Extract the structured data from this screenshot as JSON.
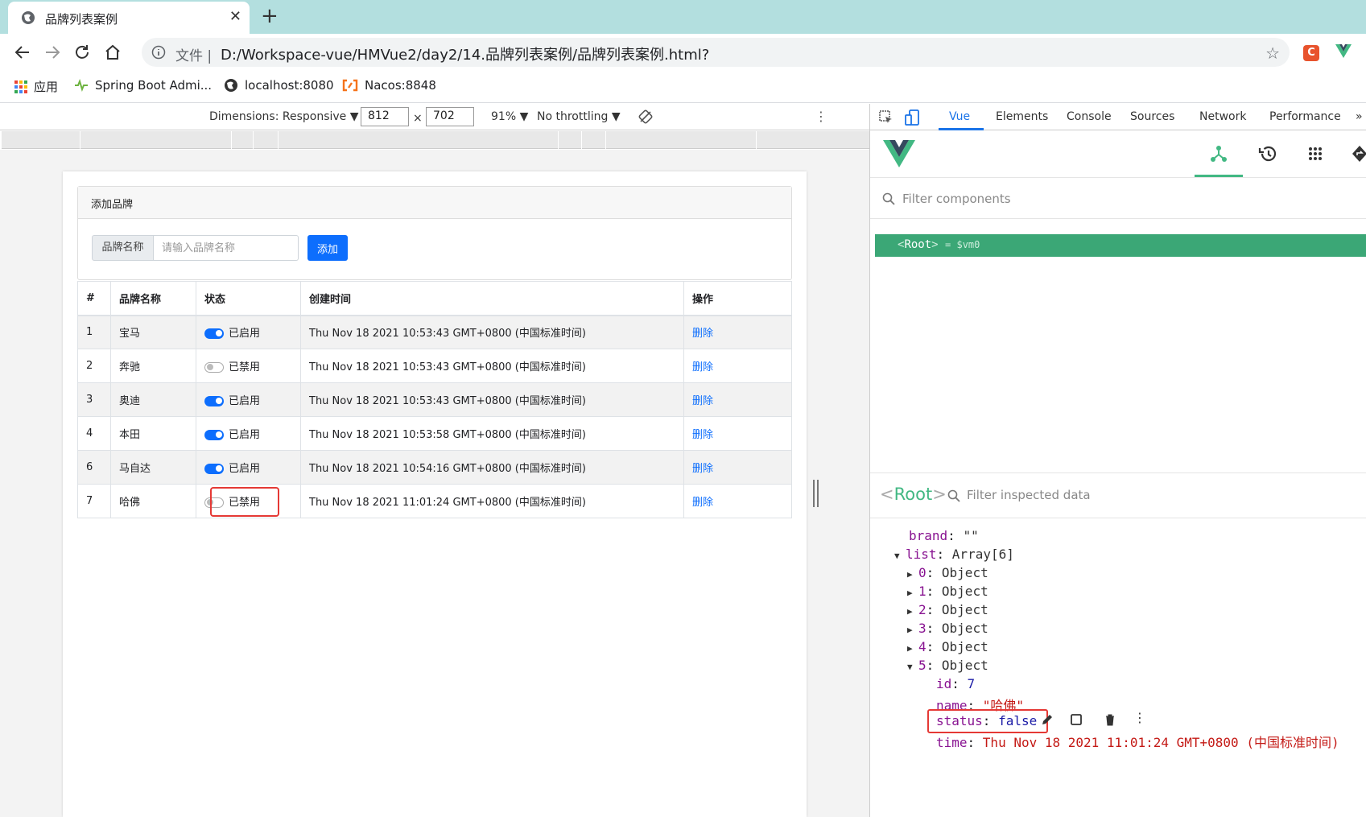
{
  "browser": {
    "tab_title": "品牌列表案例",
    "address_prefix": "文件",
    "url": "D:/Workspace-vue/HMVue2/day2/14.品牌列表案例/品牌列表案例.html?",
    "bookmarks": [
      "应用",
      "Spring Boot Admi...",
      "localhost:8080",
      "Nacos:8848"
    ]
  },
  "device_toolbar": {
    "dimensions_label": "Dimensions: Responsive ▼",
    "width": "812",
    "times": "×",
    "height": "702",
    "zoom": "91% ▼",
    "throttle": "No throttling ▼"
  },
  "app": {
    "card_title": "添加品牌",
    "input_label": "品牌名称",
    "input_placeholder": "请输入品牌名称",
    "input_value": "",
    "add_button": "添加",
    "columns": [
      "#",
      "品牌名称",
      "状态",
      "创建时间",
      "操作"
    ],
    "rows": [
      {
        "id": "1",
        "name": "宝马",
        "status_on": true,
        "status": "已启用",
        "time": "Thu Nov 18 2021 10:53:43 GMT+0800 (中国标准时间)",
        "action": "删除"
      },
      {
        "id": "2",
        "name": "奔驰",
        "status_on": false,
        "status": "已禁用",
        "time": "Thu Nov 18 2021 10:53:43 GMT+0800 (中国标准时间)",
        "action": "删除"
      },
      {
        "id": "3",
        "name": "奥迪",
        "status_on": true,
        "status": "已启用",
        "time": "Thu Nov 18 2021 10:53:43 GMT+0800 (中国标准时间)",
        "action": "删除"
      },
      {
        "id": "4",
        "name": "本田",
        "status_on": true,
        "status": "已启用",
        "time": "Thu Nov 18 2021 10:53:58 GMT+0800 (中国标准时间)",
        "action": "删除"
      },
      {
        "id": "6",
        "name": "马自达",
        "status_on": true,
        "status": "已启用",
        "time": "Thu Nov 18 2021 10:54:16 GMT+0800 (中国标准时间)",
        "action": "删除"
      },
      {
        "id": "7",
        "name": "哈佛",
        "status_on": false,
        "status": "已禁用",
        "time": "Thu Nov 18 2021 11:01:24 GMT+0800 (中国标准时间)",
        "action": "删除"
      }
    ]
  },
  "devtools": {
    "tabs": [
      "Vue",
      "Elements",
      "Console",
      "Sources",
      "Network",
      "Performance",
      "»"
    ],
    "filter_components_placeholder": "Filter components",
    "root_tag_open": "<",
    "root_tag_name": "Root",
    "root_tag_close": ">",
    "root_assign": "= $vm0",
    "inspect_root": "Root",
    "filter_inspected_placeholder": "Filter inspected data",
    "state": {
      "brand_key": "brand",
      "brand_val": "\"\"",
      "list_key": "list",
      "list_val": "Array[6]",
      "items": [
        {
          "key": "0",
          "val": "Object"
        },
        {
          "key": "1",
          "val": "Object"
        },
        {
          "key": "2",
          "val": "Object"
        },
        {
          "key": "3",
          "val": "Object"
        },
        {
          "key": "4",
          "val": "Object"
        },
        {
          "key": "5",
          "val": "Object"
        }
      ],
      "id_key": "id",
      "id_val": "7",
      "name_key": "name",
      "name_val": "\"哈佛\"",
      "status_key": "status",
      "status_val": "false",
      "time_key": "time",
      "time_val": "Thu Nov 18 2021 11:01:24 GMT+0800 (中国标准时间)"
    }
  },
  "colors": {
    "tab_strip": "#b3dfdf",
    "primary": "#0d6efd",
    "vue_green": "#42b883",
    "highlight": "#e53935"
  }
}
